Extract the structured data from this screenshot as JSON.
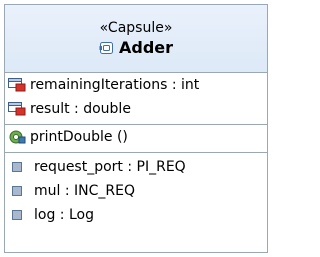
{
  "capsule": {
    "stereotype": "«Capsule»",
    "name": "Adder",
    "name_icon": "capsule-icon"
  },
  "attributes": [
    {
      "label": "remainingIterations : int",
      "icon": "attribute-icon"
    },
    {
      "label": "result : double",
      "icon": "attribute-icon"
    }
  ],
  "operations": [
    {
      "label": "printDouble ()",
      "icon": "operation-icon"
    }
  ],
  "ports": [
    {
      "label": "request_port : PI_REQ",
      "icon": "port-icon"
    },
    {
      "label": "mul : INC_REQ",
      "icon": "port-icon"
    },
    {
      "label": "log : Log",
      "icon": "port-icon"
    }
  ],
  "colors": {
    "border": "#9aa7b5",
    "header_bg": "#e2ecf8",
    "attribute_icon_red": "#d6322a",
    "port_icon": "#7c8fa6"
  }
}
